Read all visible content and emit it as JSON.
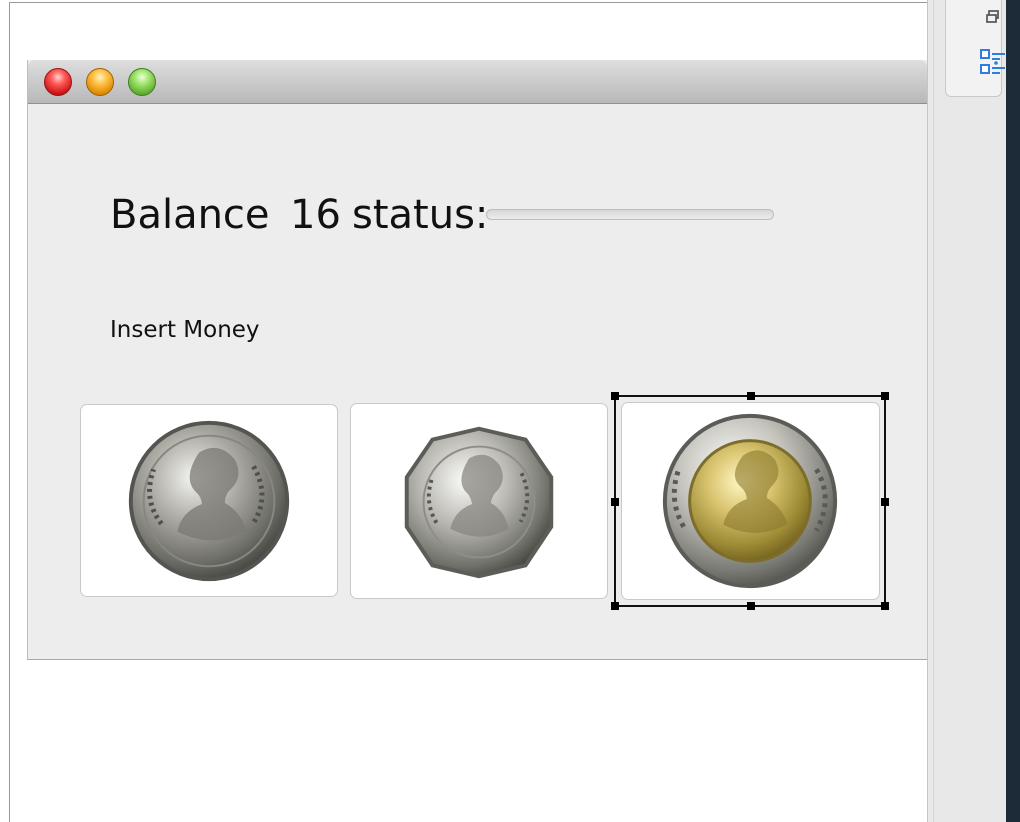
{
  "designed_window": {
    "balance_label": "Balance",
    "balance_value": "16",
    "status_label": "status:",
    "status_progress": 0,
    "insert_money_label": "Insert Money",
    "coins": [
      {
        "icon": "one-baht-coin-icon"
      },
      {
        "icon": "five-baht-coin-icon"
      },
      {
        "icon": "ten-baht-coin-icon",
        "selected": true
      }
    ]
  },
  "right_panel": {
    "icons": [
      "restore-icon",
      "outline-icon"
    ]
  },
  "colors": {
    "progress_fill": "#6aa6e8",
    "accent_blue": "#2f7de1",
    "selection": "#111111"
  }
}
